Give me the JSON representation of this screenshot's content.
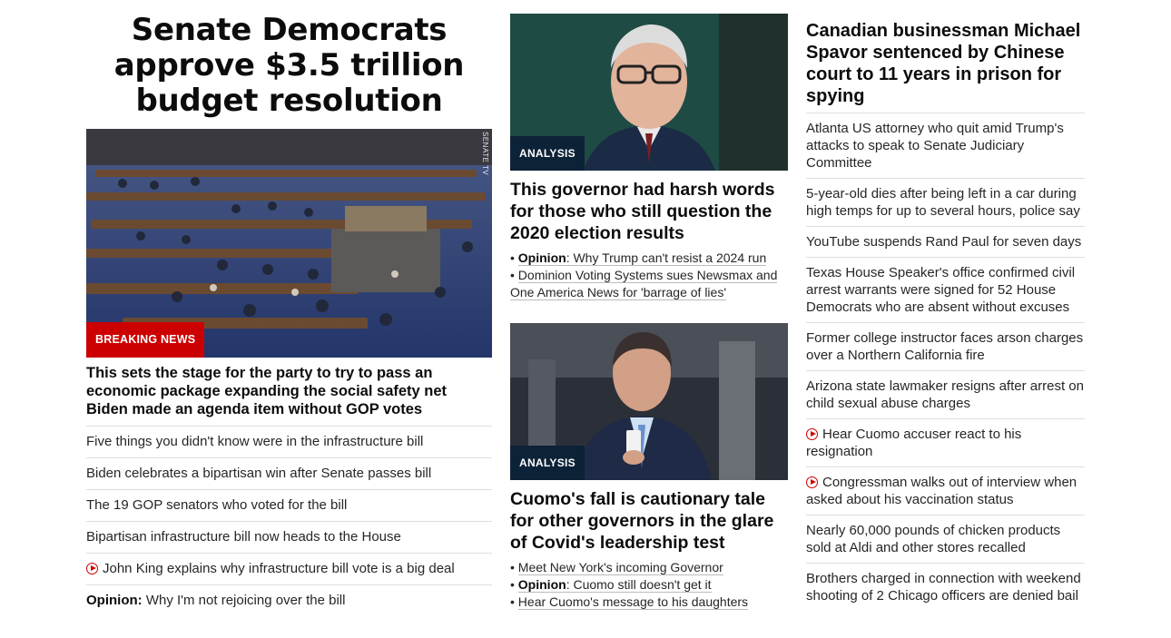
{
  "col1": {
    "headline": "Senate Democrats approve $3.5 trillion budget resolution",
    "badge": "Breaking News",
    "watermark": "SENATE TV",
    "lead": "This sets the stage for the party to try to pass an economic package expanding the social safety net Biden made an agenda item without GOP votes",
    "items": [
      {
        "text": "Five things you didn't know were in the infrastructure bill"
      },
      {
        "text": "Biden celebrates a bipartisan win after Senate passes bill"
      },
      {
        "text": "The 19 GOP senators who voted for the bill"
      },
      {
        "text": "Bipartisan infrastructure bill now heads to the House"
      },
      {
        "text": "John King explains why infrastructure bill vote is a big deal",
        "icon": "play-icon"
      },
      {
        "prefix": "Opinion:",
        "text": " Why I'm not rejoicing over the bill"
      }
    ]
  },
  "col2": {
    "card1": {
      "badge": "ANALYSIS",
      "headline": "This governor had harsh words for those who still question the 2020 election results",
      "bullets": [
        {
          "prefix": "Opinion",
          "text": ": Why Trump can't resist a 2024 run"
        },
        {
          "text": "Dominion Voting Systems sues Newsmax and One America News for 'barrage of lies'"
        }
      ]
    },
    "card2": {
      "badge": "ANALYSIS",
      "headline": "Cuomo's fall is cautionary tale for other governors in the glare of Covid's leadership test",
      "bullets": [
        {
          "text": "Meet New York's incoming Governor"
        },
        {
          "prefix": "Opinion",
          "text": ": Cuomo still doesn't get it"
        },
        {
          "text": "Hear Cuomo's message to his daughters"
        }
      ]
    }
  },
  "col3": {
    "headline": "Canadian businessman Michael Spavor sentenced by Chinese court to 11 years in prison for spying",
    "items": [
      {
        "text": "Atlanta US attorney who quit amid Trump's attacks to speak to Senate Judiciary Committee"
      },
      {
        "text": "5-year-old dies after being left in a car during high temps for up to several hours, police say"
      },
      {
        "text": "YouTube suspends Rand Paul for seven days"
      },
      {
        "text": "Texas House Speaker's office confirmed civil arrest warrants were signed for 52 House Democrats who are absent without excuses"
      },
      {
        "text": "Former college instructor faces arson charges over a Northern California fire"
      },
      {
        "text": "Arizona state lawmaker resigns after arrest on child sexual abuse charges"
      },
      {
        "text": "Hear Cuomo accuser react to his resignation",
        "icon": "play-icon"
      },
      {
        "text": "Congressman walks out of interview when asked about his vaccination status",
        "icon": "play-icon"
      },
      {
        "text": "Nearly 60,000 pounds of chicken products sold at Aldi and other stores recalled"
      },
      {
        "text": "Brothers charged in connection with weekend shooting of 2 Chicago officers are denied bail"
      }
    ]
  },
  "colors": {
    "breaking": "#cc0000",
    "analysis": "#0c2237",
    "divider": "#dedede",
    "text": "#0c0c0c"
  }
}
